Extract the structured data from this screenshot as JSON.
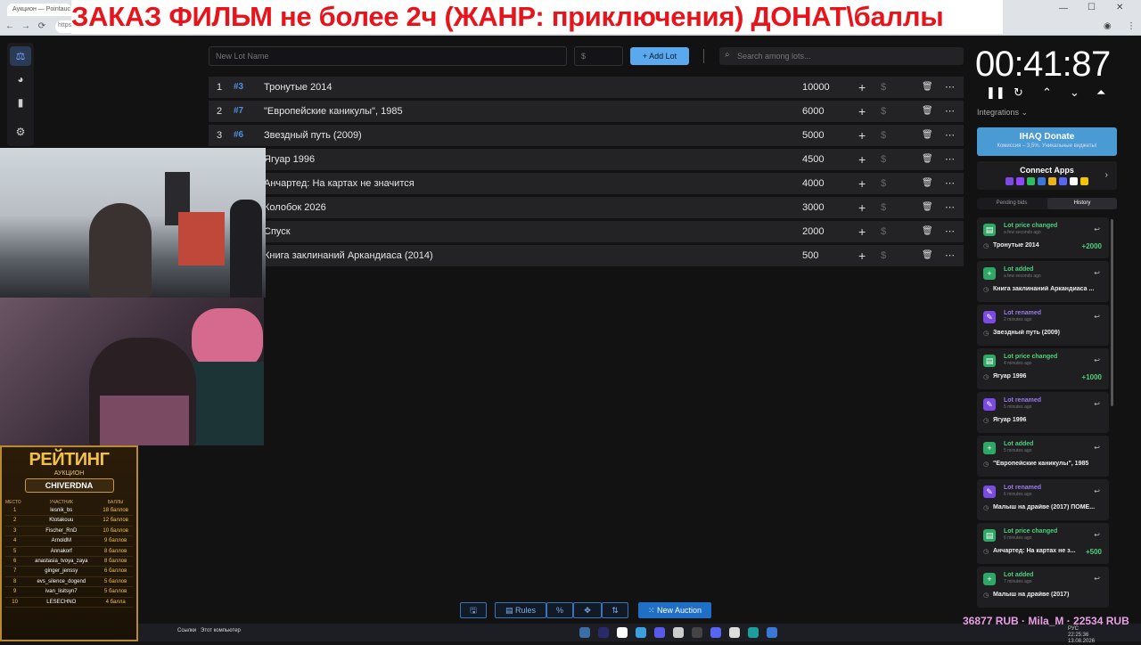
{
  "browser": {
    "tab_title": "Аукцион — Pointauc",
    "url_hint": "https",
    "nav": [
      "←",
      "→",
      "⟳",
      "⌂"
    ]
  },
  "banner": {
    "text": "ЗАКАЗ ФИЛЬМ не более 2ч (ЖАНР: приключения) ДОНАТ\\баллы",
    "color": "#e8141c"
  },
  "sidenav": {
    "items": [
      {
        "icon": "gavel-icon",
        "glyph": "⚖"
      },
      {
        "icon": "pie-chart-icon",
        "glyph": "◕"
      },
      {
        "icon": "bar-chart-icon",
        "glyph": "▮"
      },
      {
        "icon": "gear-icon",
        "glyph": "⚙"
      }
    ]
  },
  "toolbar": {
    "lot_name_placeholder": "New Lot Name",
    "amount_placeholder": "$",
    "add_lot_label": "Add Lot",
    "add_lot_icon": "+",
    "search_placeholder": "Search among lots...",
    "search_icon": "⌕"
  },
  "lots": [
    {
      "num": "1",
      "id": "#3",
      "name": "Тронутые 2014",
      "amount": "10000"
    },
    {
      "num": "2",
      "id": "#7",
      "name": "\"Европейские каникулы\", 1985",
      "amount": "6000"
    },
    {
      "num": "3",
      "id": "#6",
      "name": "Звездный путь (2009)",
      "amount": "5000"
    },
    {
      "num": "4",
      "id": "",
      "name": "Ягуар 1996",
      "amount": "4500"
    },
    {
      "num": "5",
      "id": "",
      "name": "Анчартед: На картах не значится",
      "amount": "4000"
    },
    {
      "num": "6",
      "id": "",
      "name": "Колобок 2026",
      "amount": "3000"
    },
    {
      "num": "7",
      "id": "",
      "name": "Спуск",
      "amount": "2000"
    },
    {
      "num": "8",
      "id": "",
      "name": "Книга заклинаний Аркандиаса (2014)",
      "amount": "500"
    }
  ],
  "lot_actions": {
    "plus": "+",
    "dollar": "$",
    "trash": "🗑",
    "more": "⋯"
  },
  "rating": {
    "title": "РЕЙТИНГ",
    "subtitle": "АУКЦИОН",
    "channel": "CHIVERDNA",
    "headers": [
      "МЕСТО",
      "УЧАСТНИК",
      "БАЛЛЫ"
    ],
    "rows": [
      {
        "place": "1",
        "name": "lesnik_bs",
        "score": "18 баллов"
      },
      {
        "place": "2",
        "name": "Ktotakouu",
        "score": "12 баллов"
      },
      {
        "place": "3",
        "name": "Fischer_RnD",
        "score": "10 баллов"
      },
      {
        "place": "4",
        "name": "ArnoldM",
        "score": "9 баллов"
      },
      {
        "place": "5",
        "name": "Annakorf",
        "score": "8 баллов"
      },
      {
        "place": "6",
        "name": "anastasia_tvoya_zaya",
        "score": "8 баллов"
      },
      {
        "place": "7",
        "name": "ginger_jenssy",
        "score": "6 баллов"
      },
      {
        "place": "8",
        "name": "evs_silence_dogend",
        "score": "5 баллов"
      },
      {
        "place": "9",
        "name": "ivan_lisitsyn7",
        "score": "5 баллов"
      },
      {
        "place": "10",
        "name": "LESECHNO",
        "score": "4 балла"
      }
    ]
  },
  "timer": {
    "display": "00:41:87",
    "controls": [
      "❚❚",
      "↻",
      "⌃",
      "⌄",
      "⏶"
    ]
  },
  "integrations": {
    "label": "Integrations ⌄",
    "donate_title": "IHAQ Donate",
    "donate_sub": "Комиссия – 3,5%. Уникальные виджеты!",
    "connect_title": "Connect Apps",
    "connect_chevron": "›",
    "app_colors": [
      "#7b4ae2",
      "#9146ff",
      "#2dbe60",
      "#3a78d8",
      "#e8b21c",
      "#5865f2",
      "#ffffff",
      "#f5c400"
    ]
  },
  "history_tabs": {
    "pending": "Pending bids",
    "history": "History"
  },
  "history": [
    {
      "type": "Lot price changed",
      "ago": "a few seconds ago",
      "name": "Тронутые 2014",
      "delta": "+2000",
      "color": "#2fa866",
      "icon": "▤"
    },
    {
      "type": "Lot added",
      "ago": "a few seconds ago",
      "name": "Книга заклинаний Аркандиаса ...",
      "delta": "",
      "color": "#2fa866",
      "icon": "+"
    },
    {
      "type": "Lot renamed",
      "ago": "2 minutes ago",
      "name": "Звездный путь (2009)",
      "delta": "",
      "color": "#7b4ae2",
      "icon": "✎"
    },
    {
      "type": "Lot price changed",
      "ago": "4 minutes ago",
      "name": "Ягуар 1996",
      "delta": "+1000",
      "color": "#2fa866",
      "icon": "▤"
    },
    {
      "type": "Lot renamed",
      "ago": "5 minutes ago",
      "name": "Ягуар 1996",
      "delta": "",
      "color": "#7b4ae2",
      "icon": "✎"
    },
    {
      "type": "Lot added",
      "ago": "5 minutes ago",
      "name": "\"Европейские каникулы\", 1985",
      "delta": "",
      "color": "#2fa866",
      "icon": "+"
    },
    {
      "type": "Lot renamed",
      "ago": "6 minutes ago",
      "name": "Малыш на драйве (2017) ПОМЕ...",
      "delta": "",
      "color": "#7b4ae2",
      "icon": "✎"
    },
    {
      "type": "Lot price changed",
      "ago": "6 minutes ago",
      "name": "Анчартед: На картах не з...",
      "delta": "+500",
      "color": "#2fa866",
      "icon": "▤"
    },
    {
      "type": "Lot added",
      "ago": "7 minutes ago",
      "name": "Малыш на драйве (2017)",
      "delta": "",
      "color": "#2fa866",
      "icon": "+"
    }
  ],
  "bottom": {
    "save_icon": "🖫",
    "rules_label": "Rules",
    "rules_icon": "▤",
    "percent": "%",
    "crosshair": "✥",
    "sort": "⇅",
    "new_auction_label": "New Auction",
    "new_auction_icon": "⁙"
  },
  "taskbar": {
    "links": "Ссылки",
    "computer": "Этот компьютер",
    "app_colors": [
      "#3a6ea5",
      "#2a2a6a",
      "#ffffff",
      "#3aa0e0",
      "#5a5ae8",
      "#cccccc",
      "#444",
      "#5865f2",
      "#ddd",
      "#1b9e9e",
      "#3a78d8"
    ]
  },
  "overlay_money": "36877 RUB · Mila_M · 22534 RUB",
  "tray": {
    "lang": "РУС",
    "time": "22:25:36",
    "date": "13.08.2026"
  }
}
